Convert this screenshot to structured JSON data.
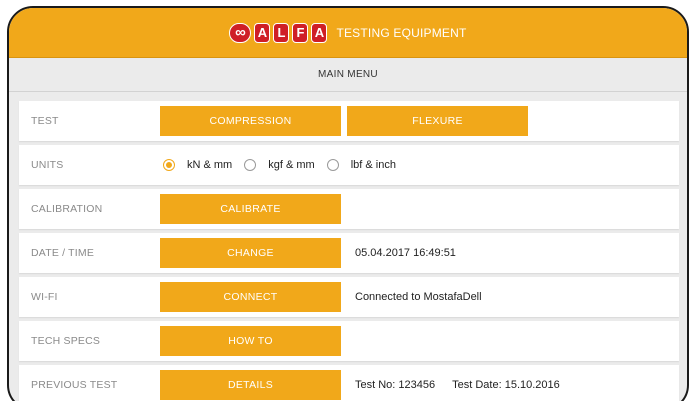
{
  "header": {
    "logo_text": "ALFA",
    "logo_letters": [
      "A",
      "L",
      "F",
      "A"
    ],
    "tagline": "TESTING EQUIPMENT"
  },
  "menu": {
    "title": "MAIN MENU"
  },
  "rows": {
    "test": {
      "label": "TEST",
      "buttons": [
        "COMPRESSION",
        "FLEXURE"
      ]
    },
    "units": {
      "label": "UNITS",
      "options": [
        "kN & mm",
        "kgf & mm",
        "lbf & inch"
      ],
      "selected": "kN & mm"
    },
    "calibration": {
      "label": "CALIBRATION",
      "button": "CALIBRATE"
    },
    "datetime": {
      "label": "DATE / TIME",
      "button": "CHANGE",
      "value": "05.04.2017 16:49:51"
    },
    "wifi": {
      "label": "WI-FI",
      "button": "CONNECT",
      "status": "Connected to MostafaDell"
    },
    "techspecs": {
      "label": "TECH SPECS",
      "button": "HOW TO"
    },
    "previous": {
      "label": "PREVIOUS TEST",
      "button": "DETAILS",
      "test_no": "Test No: 123456",
      "test_date": "Test Date: 15.10.2016"
    }
  },
  "colors": {
    "accent": "#f1a81a",
    "logo": "#cf1f26",
    "background": "#ebebeb"
  }
}
